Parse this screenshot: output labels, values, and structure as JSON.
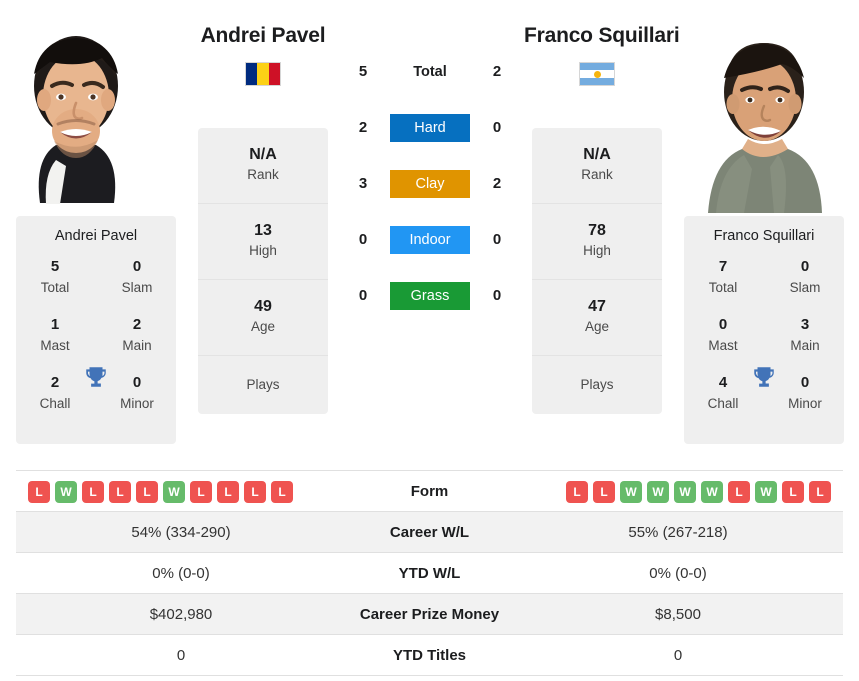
{
  "players": {
    "left": {
      "name": "Andrei Pavel",
      "flag": "romania-flag-icon",
      "photo": "player-photo",
      "rank": "N/A",
      "rank_label": "Rank",
      "high": "13",
      "high_label": "High",
      "age": "49",
      "age_label": "Age",
      "plays_label": "Plays",
      "plays_value": "",
      "titles": {
        "card_name": "Andrei Pavel",
        "total": "5",
        "total_label": "Total",
        "slam": "0",
        "slam_label": "Slam",
        "mast": "1",
        "mast_label": "Mast",
        "main": "2",
        "main_label": "Main",
        "chall": "2",
        "chall_label": "Chall",
        "minor": "0",
        "minor_label": "Minor"
      },
      "form": [
        "L",
        "W",
        "L",
        "L",
        "L",
        "W",
        "L",
        "L",
        "L",
        "L"
      ],
      "career_wl": "54% (334-290)",
      "ytd_wl": "0% (0-0)",
      "prize_money": "$402,980",
      "ytd_titles": "0"
    },
    "right": {
      "name": "Franco Squillari",
      "flag": "argentina-flag-icon",
      "photo": "player-photo",
      "rank": "N/A",
      "rank_label": "Rank",
      "high": "78",
      "high_label": "High",
      "age": "47",
      "age_label": "Age",
      "plays_label": "Plays",
      "plays_value": "",
      "titles": {
        "card_name": "Franco Squillari",
        "total": "7",
        "total_label": "Total",
        "slam": "0",
        "slam_label": "Slam",
        "mast": "0",
        "mast_label": "Mast",
        "main": "3",
        "main_label": "Main",
        "chall": "4",
        "chall_label": "Chall",
        "minor": "0",
        "minor_label": "Minor"
      },
      "form": [
        "L",
        "L",
        "W",
        "W",
        "W",
        "W",
        "L",
        "W",
        "L",
        "L"
      ],
      "career_wl": "55% (267-218)",
      "ytd_wl": "0% (0-0)",
      "prize_money": "$8,500",
      "ytd_titles": "0"
    }
  },
  "surfaces": [
    {
      "label": "Total",
      "left": "5",
      "right": "2",
      "style": "plain",
      "color": ""
    },
    {
      "label": "Hard",
      "left": "2",
      "right": "0",
      "style": "badge",
      "color": "#0670c0"
    },
    {
      "label": "Clay",
      "left": "3",
      "right": "2",
      "style": "badge",
      "color": "#e09400"
    },
    {
      "label": "Indoor",
      "left": "0",
      "right": "0",
      "style": "badge",
      "color": "#2196f3"
    },
    {
      "label": "Grass",
      "left": "0",
      "right": "0",
      "style": "badge",
      "color": "#199a35"
    }
  ],
  "stats_rows": [
    {
      "label": "Form",
      "left": "",
      "right": "",
      "type": "form"
    },
    {
      "label": "Career W/L",
      "left": "54% (334-290)",
      "right": "55% (267-218)",
      "type": "text"
    },
    {
      "label": "YTD W/L",
      "left": "0% (0-0)",
      "right": "0% (0-0)",
      "type": "text"
    },
    {
      "label": "Career Prize Money",
      "left": "$402,980",
      "right": "$8,500",
      "type": "text"
    },
    {
      "label": "YTD Titles",
      "left": "0",
      "right": "0",
      "type": "text"
    }
  ],
  "colors": {
    "hard": "#0670c0",
    "clay": "#e09400",
    "indoor": "#2196f3",
    "grass": "#199a35",
    "win": "#66bb6a",
    "loss": "#ef5350",
    "trophy": "#4273b8",
    "panel": "#efefef",
    "row_alt": "#f2f2f2"
  },
  "icons": {
    "trophy": "trophy-icon",
    "flag_left": "romania-flag-icon",
    "flag_right": "argentina-flag-icon"
  }
}
